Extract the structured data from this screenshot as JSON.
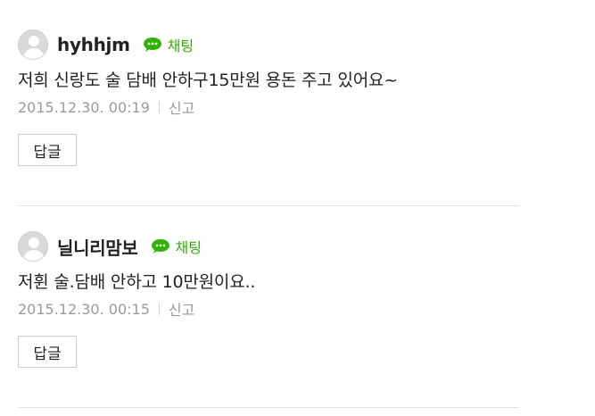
{
  "comments": [
    {
      "username": "hyhhjm",
      "chat_label": "채팅",
      "text": "저희 신랑도 술 담배 안하구15만원 용돈 주고 있어요~",
      "timestamp": "2015.12.30. 00:19",
      "report_label": "신고",
      "reply_label": "답글"
    },
    {
      "username": "닐니리맘보",
      "chat_label": "채팅",
      "text": "저휜 술.담배 안하고 10만원이요..",
      "timestamp": "2015.12.30. 00:15",
      "report_label": "신고",
      "reply_label": "답글"
    }
  ],
  "colors": {
    "chat_green": "#2db400",
    "meta_gray": "#9a9a9a"
  },
  "icons": {
    "avatar": "default-profile-icon",
    "chat": "chat-bubble-icon"
  }
}
